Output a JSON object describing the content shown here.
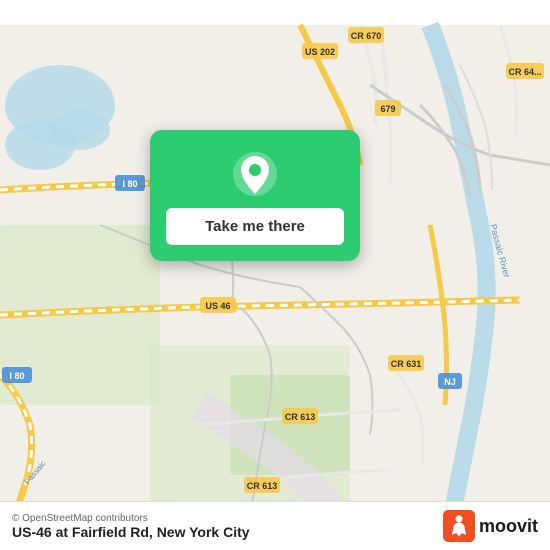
{
  "map": {
    "attribution": "© OpenStreetMap contributors",
    "location_title": "US-46 at Fairfield Rd, New York City"
  },
  "popup": {
    "button_label": "Take me there"
  },
  "moovit": {
    "text": "moovit"
  },
  "road_labels": {
    "cr670": "CR 670",
    "us202": "US 202",
    "cr679": "679",
    "cr644": "CR 64",
    "i80_top": "I 80",
    "us46": "US 46",
    "cr613_1": "CR 613",
    "cr631": "CR 631",
    "nj": "NJ",
    "cr613_2": "CR 613",
    "i80_left": "I 80",
    "passaic_river": "Passaic River",
    "passaic_r": "Passaio"
  }
}
